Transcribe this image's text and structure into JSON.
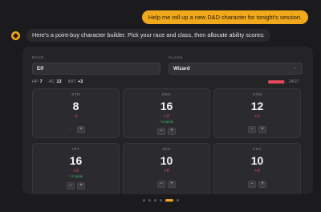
{
  "chat": {
    "user_message": "Help me roll up a new D&D character for tonight's session.",
    "assistant_message": "Here's a point-buy character builder. Pick your race and class, then allocate ability scores:"
  },
  "builder": {
    "race_label": "RACE",
    "race_value": "Elf",
    "class_label": "CLASS",
    "class_value": "Wizard",
    "chevron": "⌄",
    "stats": {
      "hp_label": "HP",
      "hp_value": "7",
      "ac_label": "AC",
      "ac_value": "13",
      "init_label": "INIT",
      "init_value": "+3"
    },
    "points_text": "24/27",
    "points_fraction": 0.889,
    "accent_color": "#f0a81c",
    "negative_color": "#e64a5a",
    "racial_color": "#3fbf6a",
    "abilities": [
      {
        "abbr": "STR",
        "score": "8",
        "mod": "-1",
        "racial": "",
        "minus": "−",
        "plus": "+"
      },
      {
        "abbr": "DEX",
        "score": "16",
        "mod": "+3",
        "racial": "+2 racial",
        "minus": "−",
        "plus": "+"
      },
      {
        "abbr": "CON",
        "score": "12",
        "mod": "+1",
        "racial": "",
        "minus": "−",
        "plus": "+"
      },
      {
        "abbr": "INT",
        "score": "16",
        "mod": "+3",
        "racial": "+1 racial",
        "minus": "−",
        "plus": "+"
      },
      {
        "abbr": "WIS",
        "score": "10",
        "mod": "+0",
        "racial": "",
        "minus": "−",
        "plus": "+"
      },
      {
        "abbr": "CHA",
        "score": "10",
        "mod": "+0",
        "racial": "",
        "minus": "−",
        "plus": "+"
      }
    ]
  },
  "pagination": {
    "count": 6,
    "active": 4
  }
}
